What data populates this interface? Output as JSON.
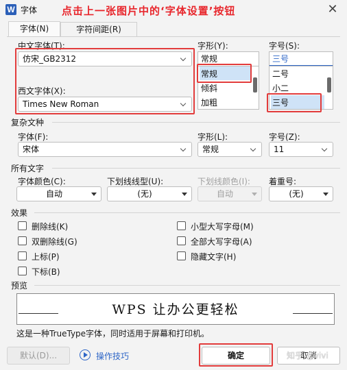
{
  "window": {
    "app_icon_letter": "W",
    "title": "字体",
    "annotation": "点击上一张图片中的‘字体设置’按钮",
    "close_glyph": "✕"
  },
  "tabs": [
    {
      "label": "字体(N)"
    },
    {
      "label": "字符间距(R)"
    }
  ],
  "chinese_font": {
    "label": "中文字体(T):",
    "value": "仿宋_GB2312"
  },
  "western_font": {
    "label": "西文字体(X):",
    "value": "Times New Roman"
  },
  "style": {
    "label": "字形(Y):",
    "value": "常规",
    "options": [
      "常规",
      "倾斜",
      "加粗"
    ],
    "selected": "常规"
  },
  "size": {
    "label": "字号(S):",
    "value": "三号",
    "options": [
      "二号",
      "小二",
      "三号"
    ],
    "selected": "三号"
  },
  "complex": {
    "section": "复杂文种",
    "font_label": "字体(F):",
    "font_value": "宋体",
    "style_label": "字形(L):",
    "style_value": "常规",
    "size_label": "字号(Z):",
    "size_value": "11"
  },
  "all_text": {
    "section": "所有文字",
    "color_label": "字体颜色(C):",
    "color_value": "自动",
    "underline_label": "下划线线型(U):",
    "underline_value": "(无)",
    "underline_color_label": "下划线颜色(I):",
    "underline_color_value": "自动",
    "emphasis_label": "着重号:",
    "emphasis_value": "(无)"
  },
  "effects": {
    "section": "效果",
    "left": [
      "删除线(K)",
      "双删除线(G)",
      "上标(P)",
      "下标(B)"
    ],
    "right": [
      "小型大写字母(M)",
      "全部大写字母(A)",
      "隐藏文字(H)"
    ]
  },
  "preview": {
    "section": "预览",
    "sample": "WPS 让办公更轻松",
    "note": "这是一种TrueType字体，同时适用于屏幕和打印机。"
  },
  "buttons": {
    "default": "默认(D)...",
    "tips": "操作技巧",
    "ok": "确定",
    "cancel": "取消"
  },
  "watermark": "知乎 @vivi",
  "colors": {
    "highlight_red": "#e23b3b",
    "accent_blue": "#2e66c7",
    "selection": "#cfe3f7"
  }
}
